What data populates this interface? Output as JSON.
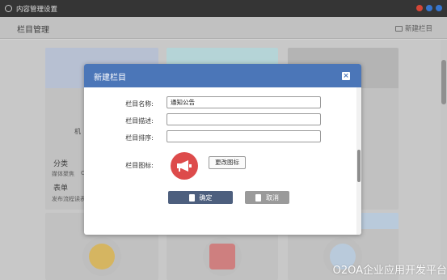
{
  "window": {
    "title": "内容管理设置",
    "controls": [
      "#e74c3c",
      "#3b7fe0",
      "#3b7fe0"
    ]
  },
  "header": {
    "title": "栏目管理",
    "new_column_label": "新建栏目"
  },
  "background": {
    "card1_text": "机",
    "category_title": "分类",
    "category_desc": "媒体聚焦",
    "category_mark": "C",
    "form_title": "表单",
    "form_desc": "发布流程读表",
    "card_head_colors": [
      "#c7d1e4",
      "#c5e6ea",
      "#c4c4c4"
    ],
    "icon_colors": [
      "#e8c56a",
      "#e08a8a",
      "#c9dcee"
    ]
  },
  "dialog": {
    "title": "新建栏目",
    "close_icon": "close-icon",
    "fields": {
      "name_label": "栏目名称:",
      "name_value": "通知公告",
      "desc_label": "栏目描述:",
      "desc_value": "",
      "order_label": "栏目排序:",
      "order_value": "",
      "icon_label": "栏目图标:"
    },
    "icon_preview": "megaphone-icon",
    "change_icon_label": "更改图标",
    "confirm_label": "确定",
    "cancel_label": "取消"
  },
  "watermark": "O2OA企业应用开发平台"
}
